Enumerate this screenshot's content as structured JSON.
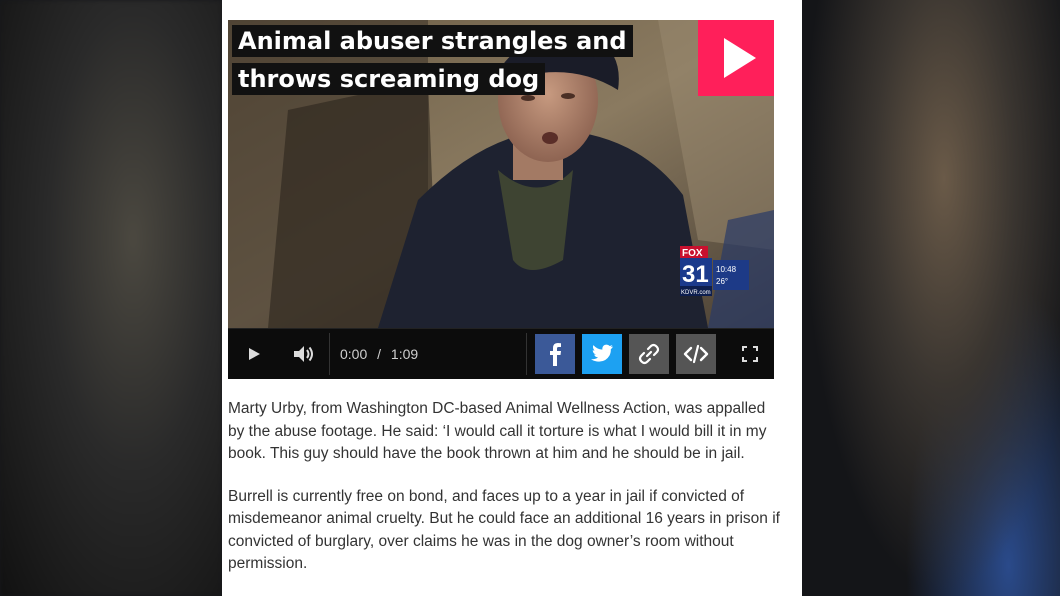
{
  "video": {
    "headline": "Animal abuser strangles and throws screaming dog",
    "current_time": "0:00",
    "time_separator": "/",
    "duration": "1:09",
    "play_overlay_icon": "play-icon",
    "accent_color": "#ff1f5a",
    "broadcaster_logo": {
      "top": "FOX",
      "channel": "31",
      "site": "KDVR.com",
      "clock": "10:48",
      "temperature": "26°"
    },
    "controls": {
      "play_icon": "play-icon",
      "volume_icon": "volume-icon",
      "fullscreen_icon": "fullscreen-icon"
    },
    "share_buttons": [
      {
        "name": "facebook",
        "icon": "facebook-icon",
        "color": "#3b5998"
      },
      {
        "name": "twitter",
        "icon": "twitter-icon",
        "color": "#1da1f2"
      },
      {
        "name": "link",
        "icon": "link-icon",
        "color": "#555555"
      },
      {
        "name": "embed",
        "icon": "embed-icon",
        "color": "#555555"
      }
    ]
  },
  "article": {
    "paragraphs": [
      "Marty Urby, from Washington DC-based Animal Wellness Action, was appalled by the abuse footage. He said: ‘I would call it torture is what I would bill it in my book. This guy should have the book thrown at him and he should be in jail.",
      "Burrell is currently free on bond, and faces up to a year in jail if convicted of misdemeanor animal cruelty. But he could face an additional 16 years in prison if convicted of burglary, over claims he was in the dog owner’s room without permission."
    ]
  }
}
